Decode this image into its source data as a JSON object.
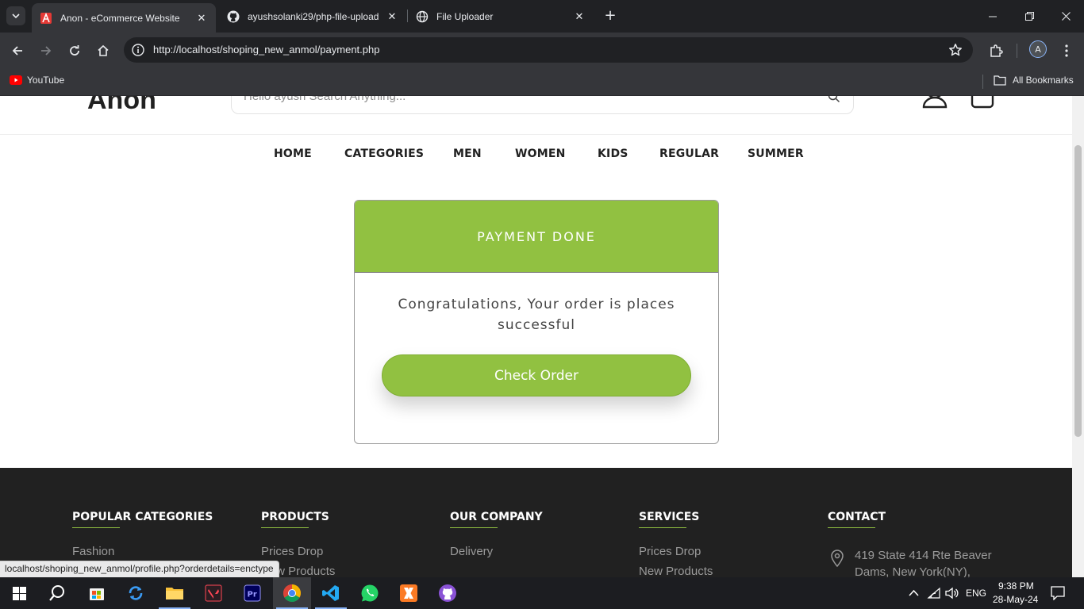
{
  "browser": {
    "tabs": [
      {
        "title": "Anon - eCommerce Website",
        "active": true,
        "favicon": "anon-logo-icon"
      },
      {
        "title": "ayushsolanki29/php-file-upload",
        "active": false,
        "favicon": "github-icon"
      },
      {
        "title": "File Uploader",
        "active": false,
        "favicon": "globe-icon"
      }
    ],
    "url": "http://localhost/shoping_new_anmol/payment.php",
    "profile_initial": "A",
    "bookmarks": [
      {
        "label": "YouTube",
        "icon": "youtube-icon"
      }
    ],
    "all_bookmarks_label": "All Bookmarks"
  },
  "site": {
    "logo": "Anon",
    "search_placeholder": "Hello ayush Search Anything...",
    "nav": [
      "HOME",
      "CATEGORIES",
      "MEN",
      "WOMEN",
      "KIDS",
      "REGULAR",
      "SUMMER"
    ],
    "accent_color": "#91c141"
  },
  "payment": {
    "title": "PAYMENT DONE",
    "message": "Congratulations, Your order is places successful",
    "button_label": "Check Order"
  },
  "footer": {
    "columns": [
      {
        "heading": "POPULAR CATEGORIES",
        "items": [
          "Fashion"
        ]
      },
      {
        "heading": "PRODUCTS",
        "items": [
          "Prices Drop",
          "New Products"
        ]
      },
      {
        "heading": "OUR COMPANY",
        "items": [
          "Delivery"
        ]
      },
      {
        "heading": "SERVICES",
        "items": [
          "Prices Drop",
          "New Products"
        ]
      },
      {
        "heading": "CONTACT",
        "items": [
          "419 State 414 Rte Beaver Dams, New York(NY),"
        ]
      }
    ]
  },
  "status_url": "localhost/shoping_new_anmol/profile.php?orderdetails=enctype",
  "taskbar": {
    "language": "ENG",
    "time": "9:38 PM",
    "date": "28-May-24"
  }
}
